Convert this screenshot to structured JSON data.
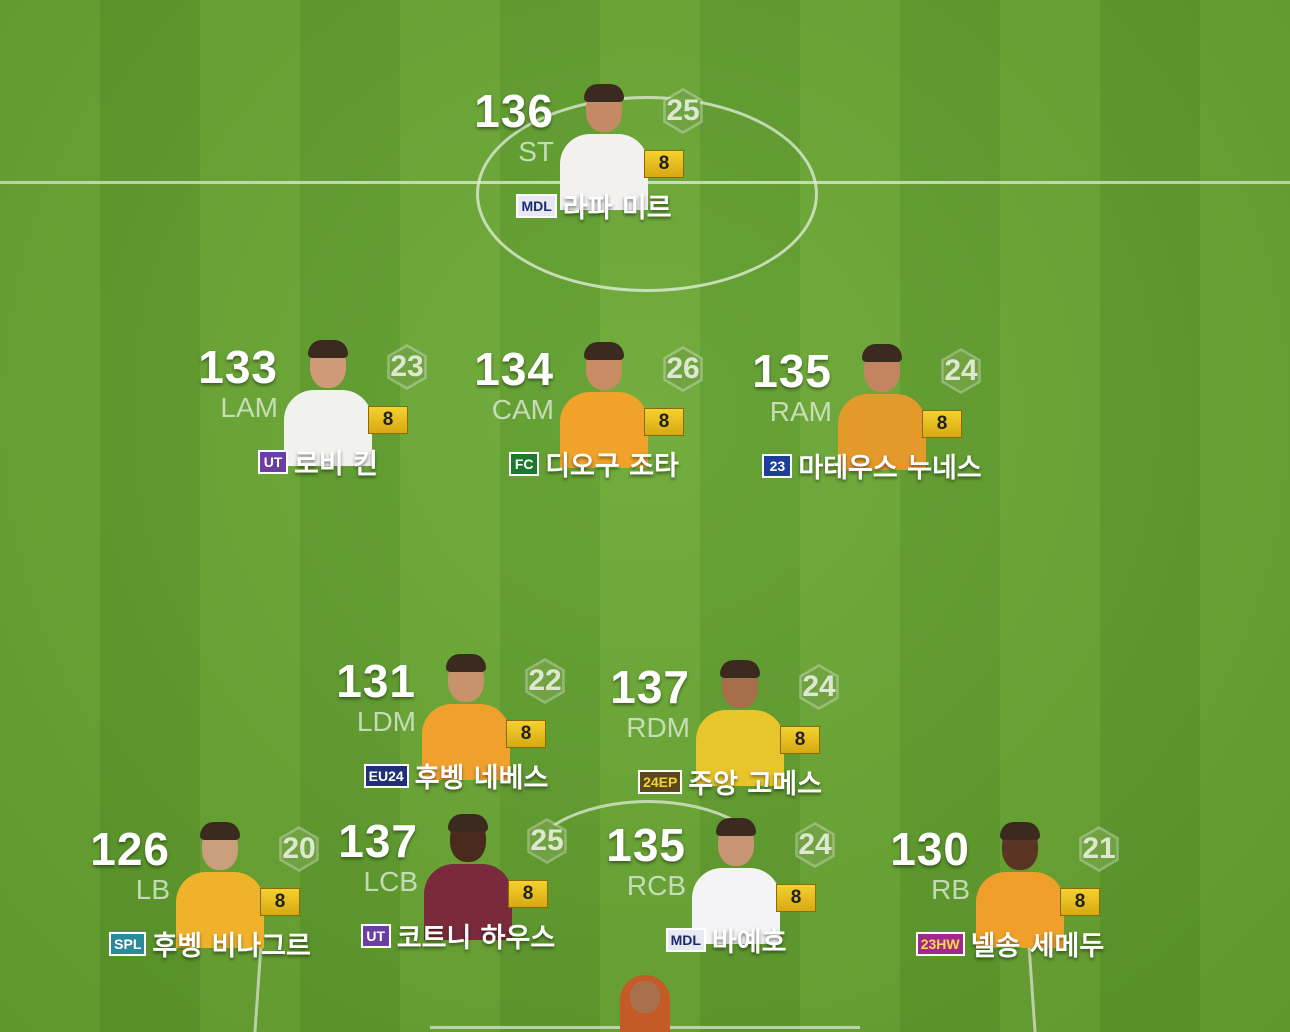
{
  "formation": {
    "players": [
      {
        "id": "st",
        "ovr": "136",
        "pos": "ST",
        "level_num": "25",
        "grade": "8",
        "season": "MDL",
        "name": "라파 미르",
        "badge_color": "#e8e8f0",
        "badge_text_color": "#1a2a70",
        "shirt": "#f3f0f0",
        "skin": "#c48a66"
      },
      {
        "id": "lam",
        "ovr": "133",
        "pos": "LAM",
        "level_num": "23",
        "grade": "8",
        "season": "UT",
        "name": "로비 킨",
        "badge_color": "#6a3fa0",
        "badge_text_color": "#ffffff",
        "shirt": "#f1f1ee",
        "skin": "#d09a78"
      },
      {
        "id": "cam",
        "ovr": "134",
        "pos": "CAM",
        "level_num": "26",
        "grade": "8",
        "season": "FC",
        "name": "디오구 조타",
        "badge_color": "#1b7a2e",
        "badge_text_color": "#ffffff",
        "shirt": "#f0a22a",
        "skin": "#c88b63"
      },
      {
        "id": "ram",
        "ovr": "135",
        "pos": "RAM",
        "level_num": "24",
        "grade": "8",
        "season": "23",
        "name": "마테우스 누네스",
        "badge_color": "#1d3f9a",
        "badge_text_color": "#ffffff",
        "shirt": "#e49a2a",
        "skin": "#c28560"
      },
      {
        "id": "ldm",
        "ovr": "131",
        "pos": "LDM",
        "level_num": "22",
        "grade": "8",
        "season": "EU24",
        "name": "후벵 네베스",
        "badge_color": "#1f2f7a",
        "badge_text_color": "#ffffff",
        "shirt": "#f0a02c",
        "skin": "#c8926c"
      },
      {
        "id": "rdm",
        "ovr": "137",
        "pos": "RDM",
        "level_num": "24",
        "grade": "8",
        "season": "24EP",
        "name": "주앙 고메스",
        "badge_color": "#5a4a1a",
        "badge_text_color": "#f4d22f",
        "shirt": "#e8c52a",
        "skin": "#a66f4a"
      },
      {
        "id": "lb",
        "ovr": "126",
        "pos": "LB",
        "level_num": "20",
        "grade": "8",
        "season": "SPL",
        "name": "후벵 비나그르",
        "badge_color": "#2a8a9a",
        "badge_text_color": "#ffffff",
        "shirt": "#efb22a",
        "skin": "#caa07c"
      },
      {
        "id": "lcb",
        "ovr": "137",
        "pos": "LCB",
        "level_num": "25",
        "grade": "8",
        "season": "UT",
        "name": "코트니 하우스",
        "badge_color": "#6a3fa0",
        "badge_text_color": "#ffffff",
        "shirt": "#7a2a3a",
        "skin": "#4a2a1c"
      },
      {
        "id": "rcb",
        "ovr": "135",
        "pos": "RCB",
        "level_num": "24",
        "grade": "8",
        "season": "MDL",
        "name": "바예호",
        "badge_color": "#e8e8f0",
        "badge_text_color": "#1a2a70",
        "shirt": "#f4f4f6",
        "skin": "#c99476"
      },
      {
        "id": "rb",
        "ovr": "130",
        "pos": "RB",
        "level_num": "21",
        "grade": "8",
        "season": "23HW",
        "name": "넬송 세메두",
        "badge_color": "#a02a8a",
        "badge_text_color": "#ffd84a",
        "shirt": "#f0a02a",
        "skin": "#5a3524"
      }
    ]
  }
}
